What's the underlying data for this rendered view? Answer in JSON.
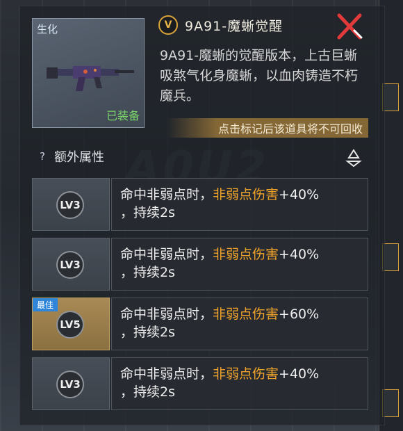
{
  "weapon": {
    "tag": "生化",
    "status": "已装备",
    "title": "9A91-魔蜥觉醒",
    "rank_icon": "V",
    "description": "9A91-魔蜥的觉醒版本，上古巨蜥吸煞气化身魔蜥，以血肉铸造不朽魔兵。"
  },
  "warning": "点击标记后该道具将不可回收",
  "extra": {
    "title": "额外属性",
    "help_icon": "?"
  },
  "attributes": [
    {
      "level": "LV3",
      "best": false,
      "pre": "命中非弱点时，",
      "highlight": "非弱点伤害",
      "value": "+40%",
      "line2": "，持续2s"
    },
    {
      "level": "LV3",
      "best": false,
      "pre": "命中非弱点时，",
      "highlight": "非弱点伤害",
      "value": "+40%",
      "line2": "，持续2s"
    },
    {
      "level": "LV5",
      "best": true,
      "best_label": "最佳",
      "pre": "命中非弱点时，",
      "highlight": "非弱点伤害",
      "value": "+60%",
      "line2": "，持续2s"
    },
    {
      "level": "LV3",
      "best": false,
      "pre": "命中非弱点时，",
      "highlight": "非弱点伤害",
      "value": "+40%",
      "line2": "，持续2s"
    }
  ],
  "colors": {
    "highlight": "#f0a32a",
    "equipped": "#7cd66a",
    "best_tag": "#2f86d8",
    "close": "#e23a3a"
  }
}
